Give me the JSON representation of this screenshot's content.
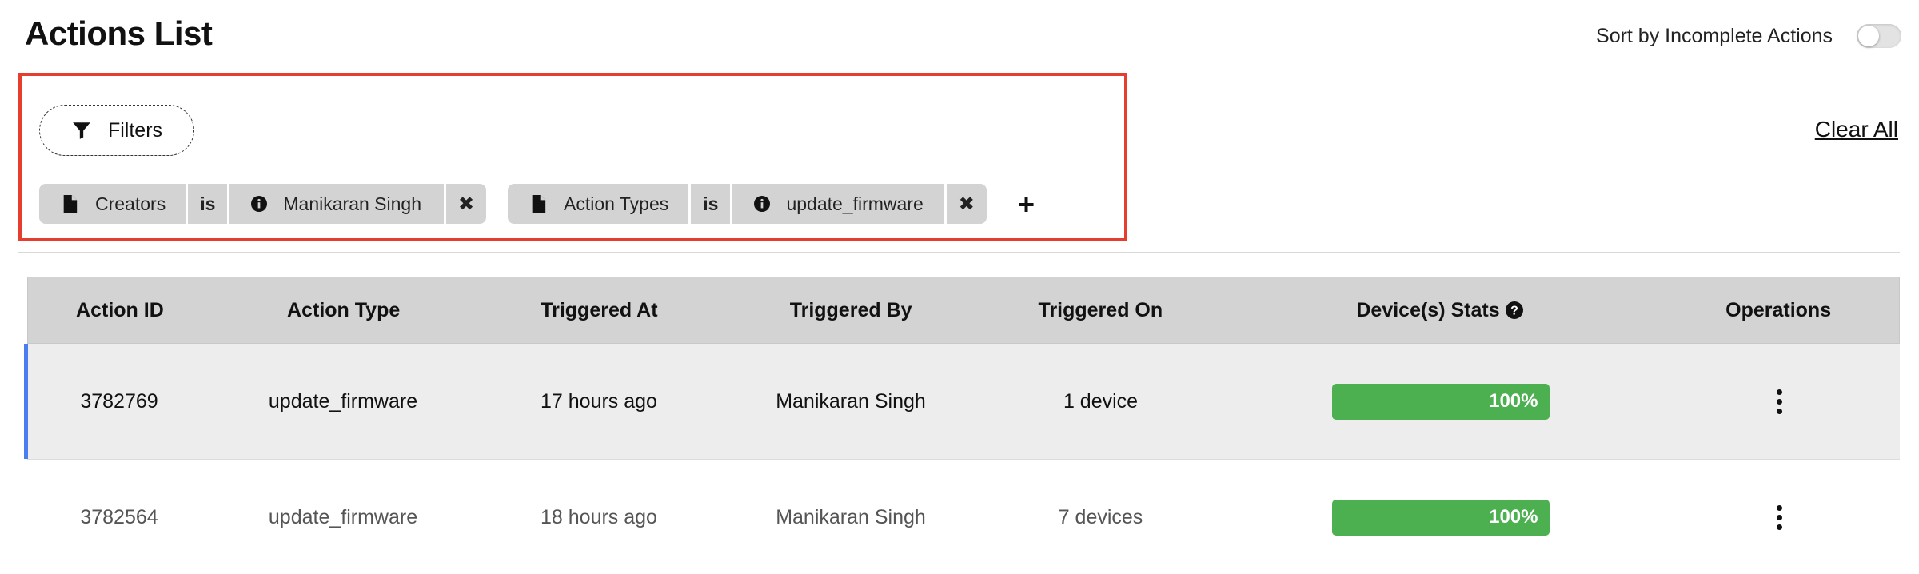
{
  "title": "Actions List",
  "sort": {
    "label": "Sort by Incomplete Actions",
    "enabled": false
  },
  "filters_button": {
    "label": "Filters",
    "icon": "filter-icon"
  },
  "clear_all": "Clear All",
  "filter_chips": [
    {
      "field": "Creators",
      "operator": "is",
      "value": "Manikaran Singh"
    },
    {
      "field": "Action Types",
      "operator": "is",
      "value": "update_firmware"
    }
  ],
  "add_filter": "+",
  "table": {
    "headers": [
      "Action ID",
      "Action Type",
      "Triggered At",
      "Triggered By",
      "Triggered On",
      "Device(s) Stats",
      "Operations"
    ],
    "rows": [
      {
        "id": "3782769",
        "type": "update_firmware",
        "at": "17 hours ago",
        "by": "Manikaran Singh",
        "on": "1 device",
        "stats": "100%",
        "progress": 1.0,
        "selected": true
      },
      {
        "id": "3782564",
        "type": "update_firmware",
        "at": "18 hours ago",
        "by": "Manikaran Singh",
        "on": "7 devices",
        "stats": "100%",
        "progress": 1.0,
        "selected": false
      }
    ]
  },
  "colors": {
    "accent": "#4a7ef0",
    "progress": "#4caf50",
    "highlight_border": "#e53e2e"
  }
}
